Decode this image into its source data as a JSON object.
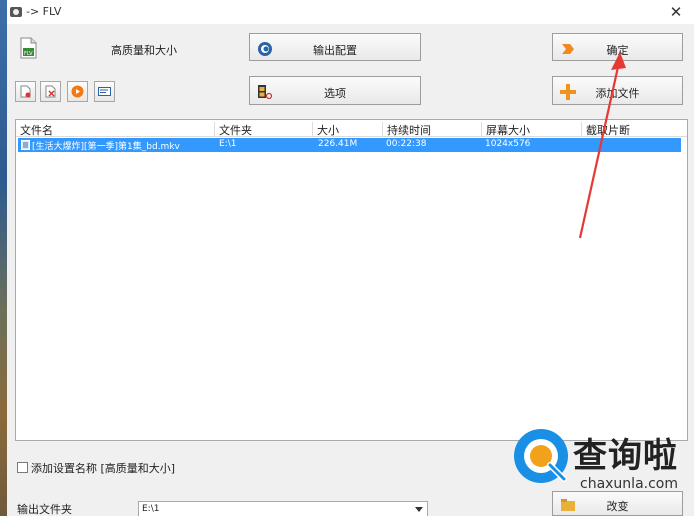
{
  "window": {
    "title": "-> FLV",
    "close_glyph": "✕"
  },
  "preset": {
    "label": "高质量和大小"
  },
  "buttons": {
    "output_config": "输出配置",
    "options": "选项",
    "confirm": "确定",
    "add_file": "添加文件",
    "change": "改变"
  },
  "toolbar_small": [
    "remove-file-icon",
    "clear-list-icon",
    "play-icon",
    "info-icon"
  ],
  "file_list": {
    "columns": [
      "文件名",
      "文件夹",
      "大小",
      "持续时间",
      "屏幕大小",
      "截取片断"
    ],
    "rows": [
      {
        "name": "[生活大爆炸][第一季]第1集_bd.mkv",
        "folder": "E:\\1",
        "size": "226.41M",
        "duration": "00:22:38",
        "screen": "1024x576",
        "clip": ""
      }
    ]
  },
  "add_setting": {
    "label": "添加设置名称 [高质量和大小]",
    "checked": false
  },
  "output_folder": {
    "label": "输出文件夹",
    "value": "E:\\1"
  },
  "watermark": {
    "text": "查询啦",
    "url": "chaxunla.com"
  },
  "colors": {
    "selection": "#3399ff",
    "annotation": "#e53935",
    "panel": "#f0f0f0"
  }
}
